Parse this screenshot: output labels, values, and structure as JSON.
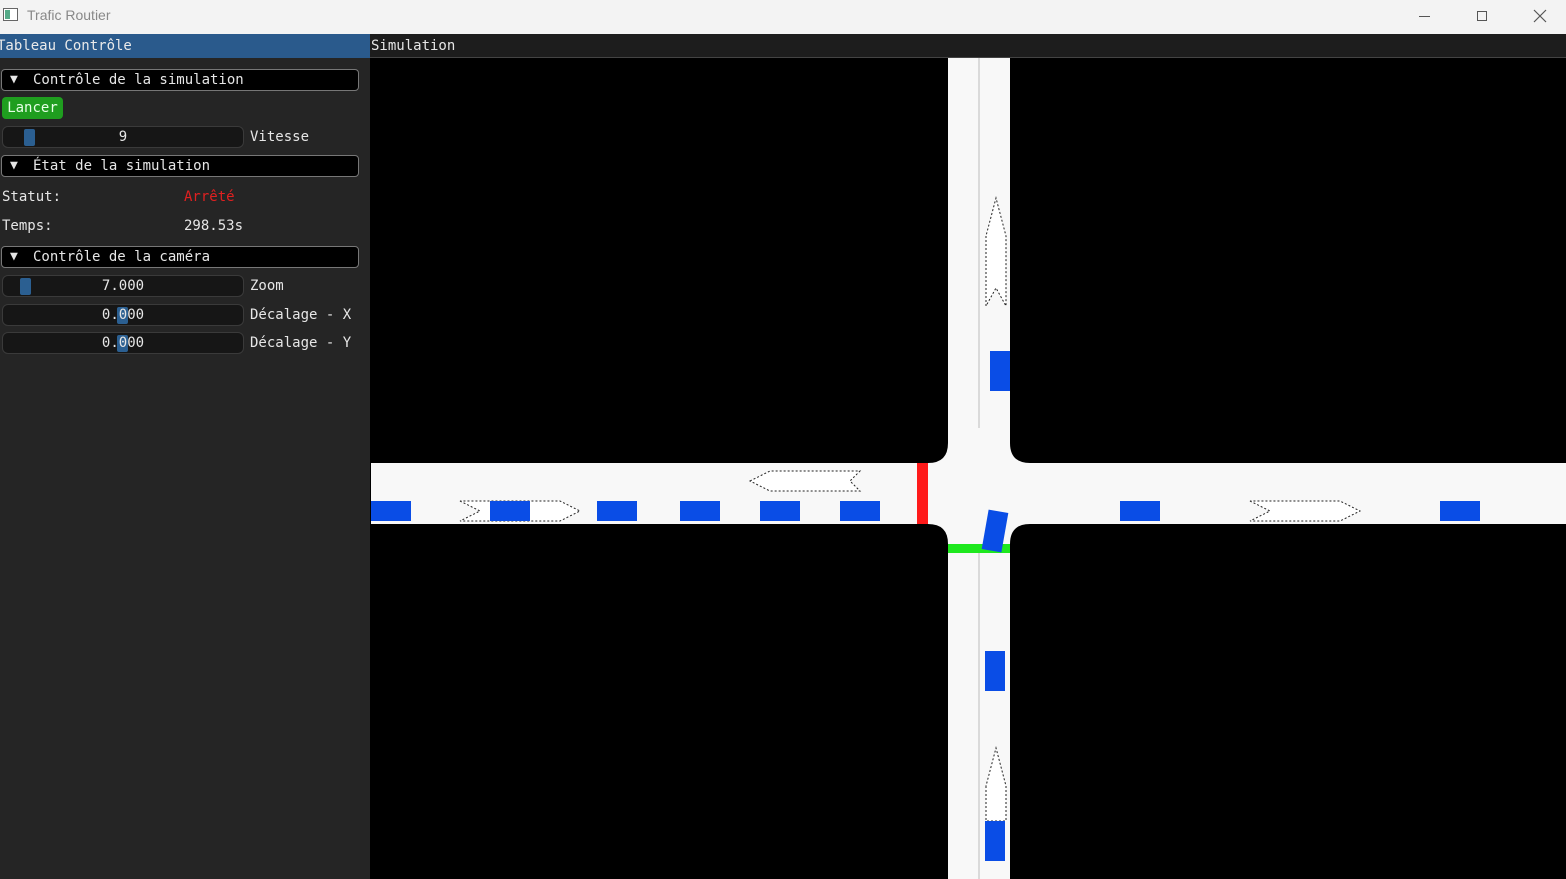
{
  "window": {
    "title": "Trafic Routier"
  },
  "panel": {
    "title": "Tableau Contrôle",
    "sim_control": {
      "header": "Contrôle de la simulation",
      "launch_button": "Lancer",
      "speed": {
        "value": "9",
        "label": "Vitesse"
      }
    },
    "sim_state": {
      "header": "État de la simulation",
      "status_label": "Statut:",
      "status_value": "Arrêté",
      "time_label": "Temps:",
      "time_value": "298.53s"
    },
    "camera": {
      "header": "Contrôle de la caméra",
      "zoom": {
        "value": "7.000",
        "label": "Zoom"
      },
      "offset_x": {
        "value": "0.000",
        "label": "Décalage - X"
      },
      "offset_y": {
        "value": "0.000",
        "label": "Décalage - Y"
      }
    }
  },
  "simulation": {
    "title": "Simulation",
    "colors": {
      "road": "#f8f8f8",
      "vehicle": "#0a4de6",
      "light_red": "#ff1a1a",
      "light_green": "#1ee81e",
      "background": "#000000"
    }
  }
}
